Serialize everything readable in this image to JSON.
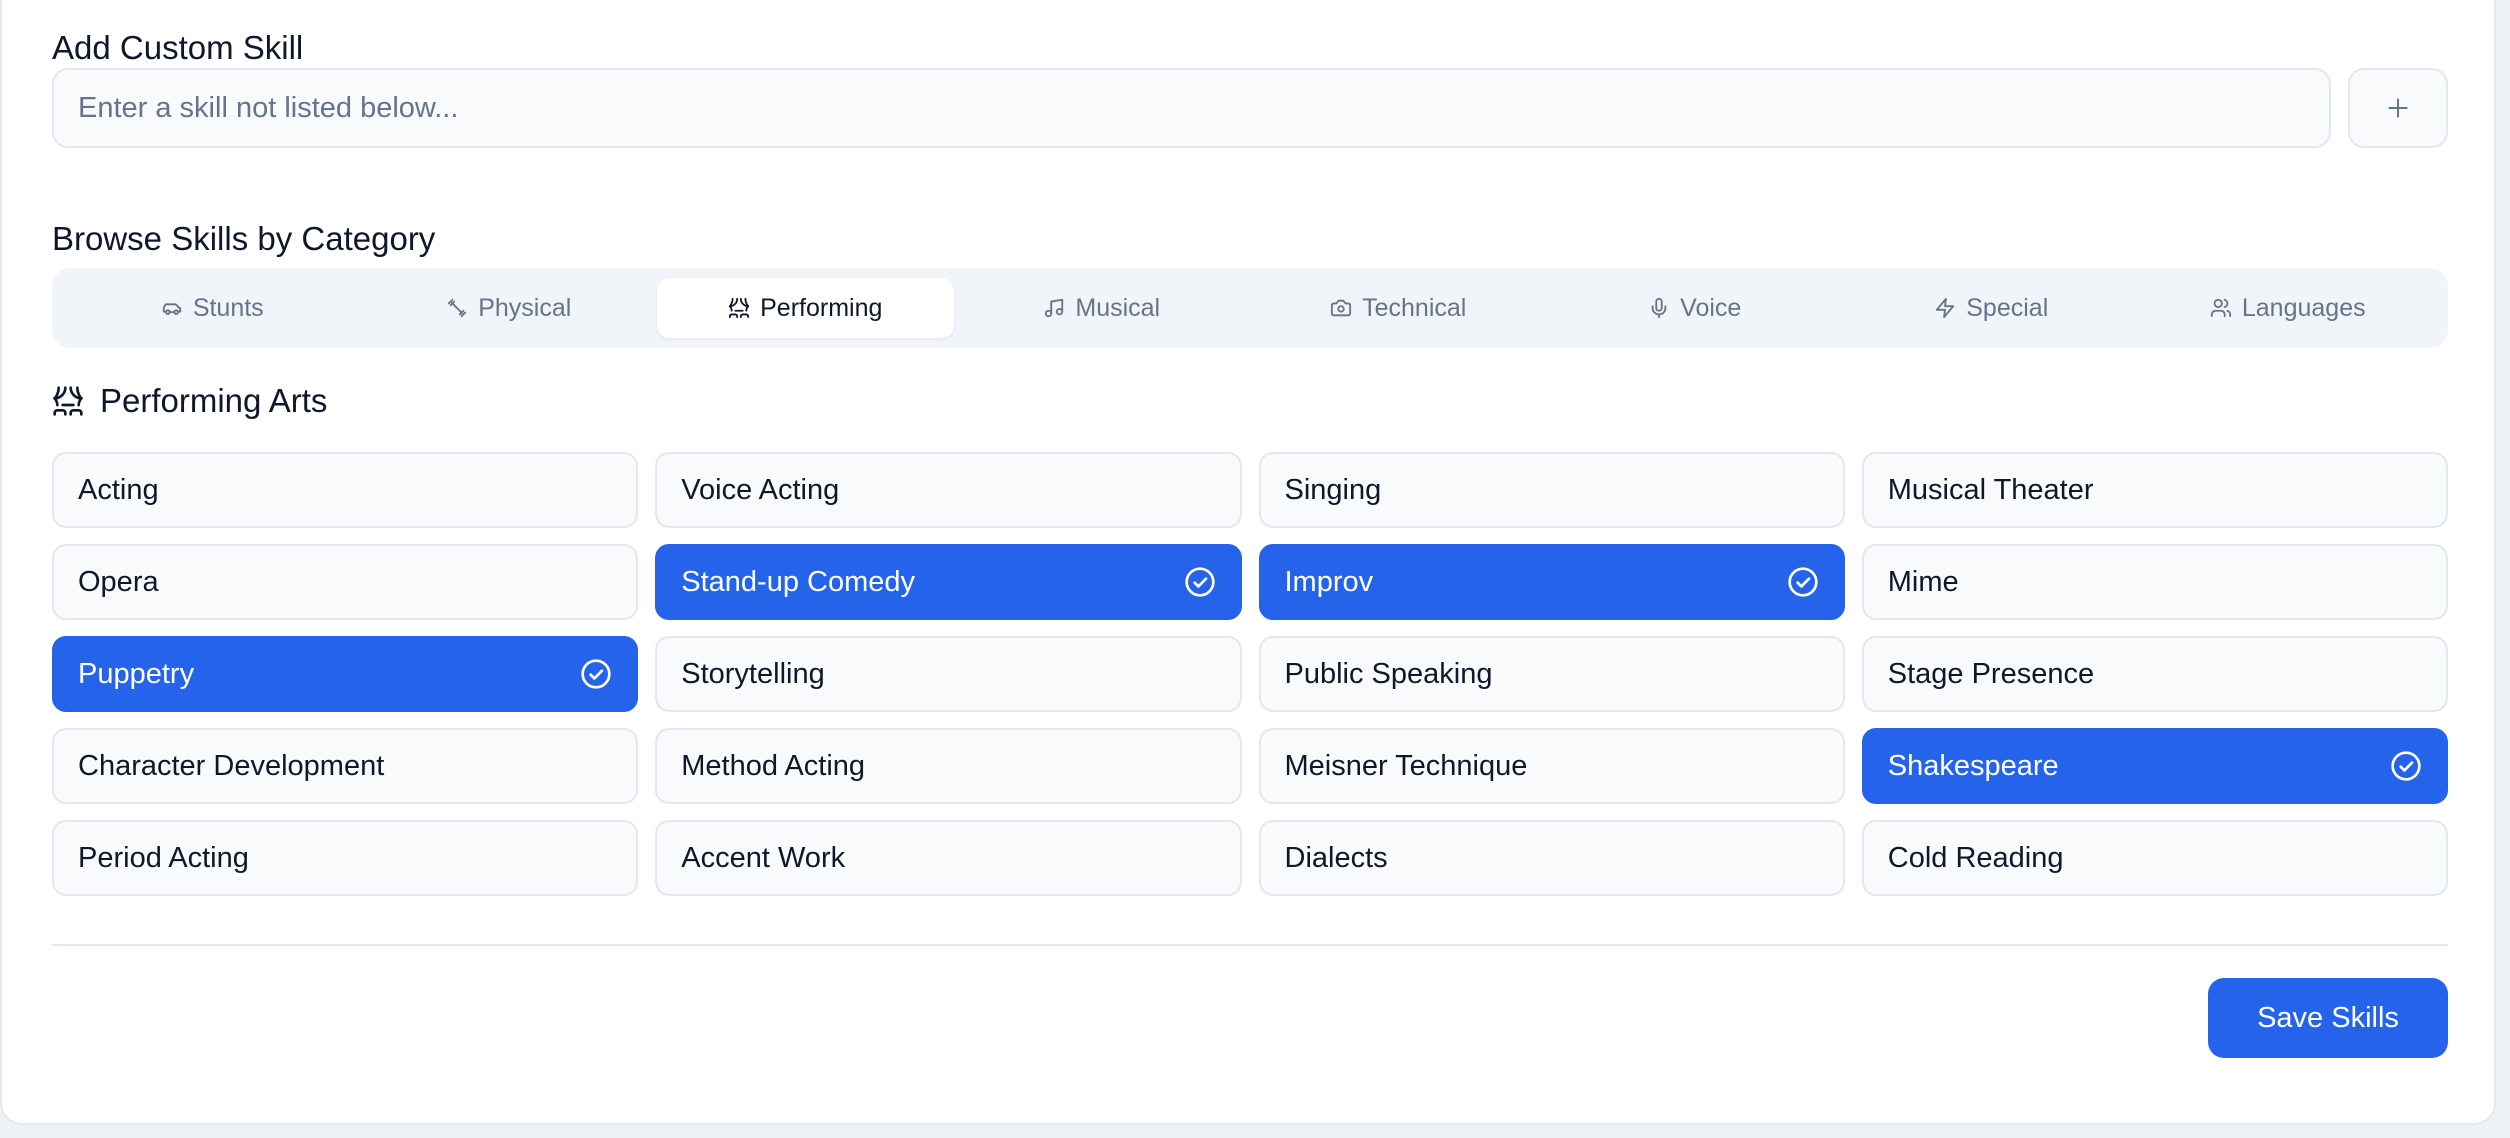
{
  "custom_skill": {
    "title": "Add Custom Skill",
    "placeholder": "Enter a skill not listed below...",
    "value": "",
    "add_icon": "plus-icon"
  },
  "browse": {
    "title": "Browse Skills by Category",
    "tabs": [
      {
        "label": "Stunts",
        "icon": "car-icon",
        "active": false
      },
      {
        "label": "Physical",
        "icon": "dumbbell-icon",
        "active": false
      },
      {
        "label": "Performing",
        "icon": "theater-icon",
        "active": true
      },
      {
        "label": "Musical",
        "icon": "music-icon",
        "active": false
      },
      {
        "label": "Technical",
        "icon": "camera-icon",
        "active": false
      },
      {
        "label": "Voice",
        "icon": "mic-icon",
        "active": false
      },
      {
        "label": "Special",
        "icon": "zap-icon",
        "active": false
      },
      {
        "label": "Languages",
        "icon": "users-icon",
        "active": false
      }
    ]
  },
  "category": {
    "title": "Performing Arts",
    "icon": "theater-icon",
    "skills": [
      {
        "label": "Acting",
        "selected": false
      },
      {
        "label": "Voice Acting",
        "selected": false
      },
      {
        "label": "Singing",
        "selected": false
      },
      {
        "label": "Musical Theater",
        "selected": false
      },
      {
        "label": "Opera",
        "selected": false
      },
      {
        "label": "Stand-up Comedy",
        "selected": true
      },
      {
        "label": "Improv",
        "selected": true
      },
      {
        "label": "Mime",
        "selected": false
      },
      {
        "label": "Puppetry",
        "selected": true
      },
      {
        "label": "Storytelling",
        "selected": false
      },
      {
        "label": "Public Speaking",
        "selected": false
      },
      {
        "label": "Stage Presence",
        "selected": false
      },
      {
        "label": "Character Development",
        "selected": false
      },
      {
        "label": "Method Acting",
        "selected": false
      },
      {
        "label": "Meisner Technique",
        "selected": false
      },
      {
        "label": "Shakespeare",
        "selected": true
      },
      {
        "label": "Period Acting",
        "selected": false
      },
      {
        "label": "Accent Work",
        "selected": false
      },
      {
        "label": "Dialects",
        "selected": false
      },
      {
        "label": "Cold Reading",
        "selected": false
      }
    ]
  },
  "actions": {
    "save_label": "Save Skills"
  },
  "colors": {
    "accent": "#2563eb",
    "chip_bg": "#f8fafc",
    "border": "#e2e8f0",
    "muted_text": "#64748b"
  }
}
